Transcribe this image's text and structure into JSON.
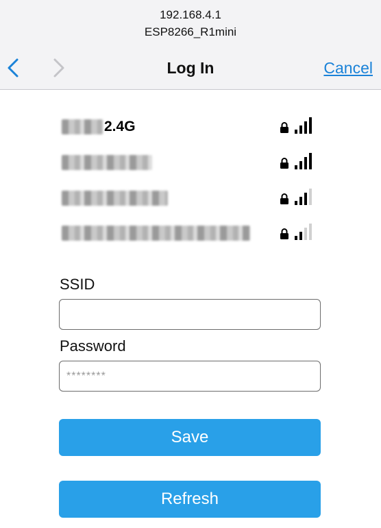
{
  "browser": {
    "host": "192.168.4.1",
    "page_ssid": "ESP8266_R1mini",
    "title": "Log In",
    "cancel_label": "Cancel",
    "back_icon": "chevron-left-icon",
    "forward_icon": "chevron-right-icon",
    "accent": "#1a82d8"
  },
  "networks": [
    {
      "name": "2.4G",
      "secured": true,
      "signal_bars": 4
    },
    {
      "name": "",
      "secured": true,
      "signal_bars": 4
    },
    {
      "name": "",
      "secured": true,
      "signal_bars": 3
    },
    {
      "name": "",
      "secured": true,
      "signal_bars": 2
    }
  ],
  "form": {
    "ssid_label": "SSID",
    "ssid_value": "",
    "password_label": "Password",
    "password_placeholder": "********",
    "save_label": "Save",
    "refresh_label": "Refresh",
    "button_color": "#29a0e8"
  }
}
